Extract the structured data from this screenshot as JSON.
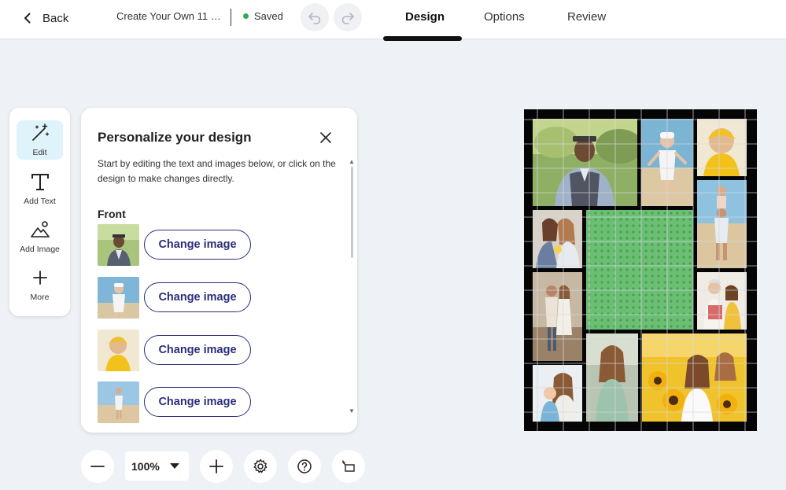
{
  "header": {
    "back_label": "Back",
    "doc_title": "Create Your Own 11 Ph...",
    "save_status": "Saved",
    "tabs": [
      {
        "label": "Design",
        "active": true
      },
      {
        "label": "Options",
        "active": false
      },
      {
        "label": "Review",
        "active": false
      }
    ],
    "undo_icon": "undo-icon",
    "redo_icon": "redo-icon"
  },
  "rail": {
    "items": [
      {
        "label": "Edit",
        "icon": "magic-wand-icon",
        "active": true
      },
      {
        "label": "Add Text",
        "icon": "text-icon",
        "active": false
      },
      {
        "label": "Add Image",
        "icon": "image-icon",
        "active": false
      },
      {
        "label": "More",
        "icon": "plus-icon",
        "active": false
      }
    ]
  },
  "panel": {
    "title": "Personalize your design",
    "description": "Start by editing the text and images below, or click on the design to make changes directly.",
    "section_label": "Front",
    "images": [
      {
        "button_label": "Change image"
      },
      {
        "button_label": "Change image"
      },
      {
        "button_label": "Change image"
      },
      {
        "button_label": "Change image"
      }
    ]
  },
  "toolbar": {
    "zoom_value": "100%",
    "zoom_out_icon": "minus-icon",
    "zoom_in_icon": "plus-icon",
    "settings_icon": "gear-icon",
    "help_icon": "question-icon",
    "crop_icon": "crop-icon"
  },
  "colors": {
    "accent": "#2a2e7a",
    "saved_dot": "#35a853",
    "edit_active_bg": "#dff3fa",
    "canvas_bg": "#050505",
    "empty_slot_green": "#6abf73"
  }
}
